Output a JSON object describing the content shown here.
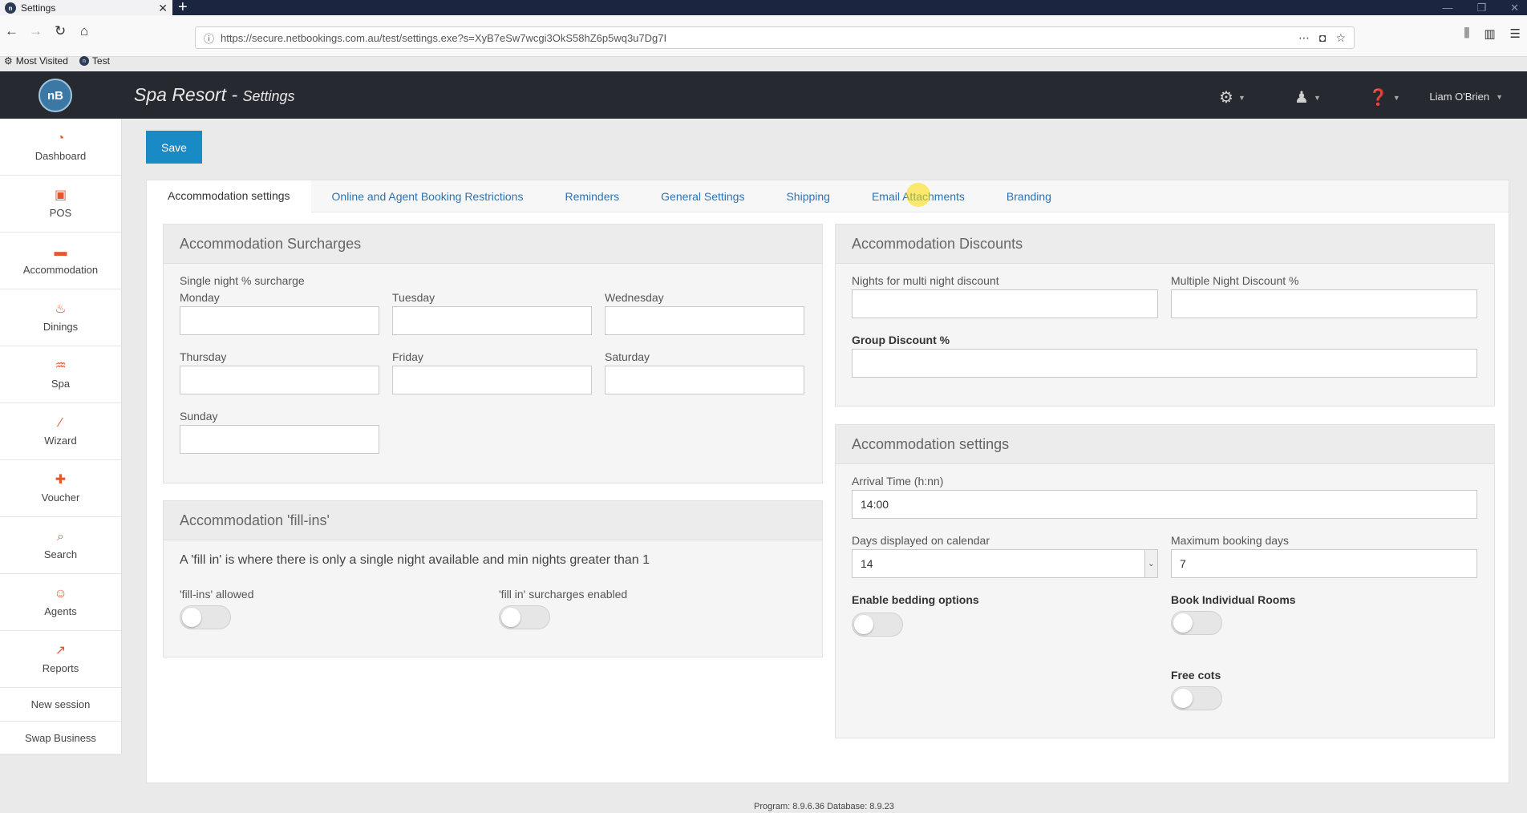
{
  "browser": {
    "tab_title": "Settings",
    "tab_close": "✕",
    "new_tab": "+",
    "url": "https://secure.netbookings.com.au/test/settings.exe?s=XyB7eSw7wcgi3OkS58hZ6p5wq3u7Dg7I",
    "bookmarks": [
      "Most Visited",
      "Test"
    ]
  },
  "app": {
    "logo": "nB",
    "title": "Spa Resort - ",
    "subtitle": "Settings",
    "user_name": "Liam O'Brien"
  },
  "sidebar": {
    "items": [
      {
        "label": "Dashboard",
        "icon": "dashboard-icon"
      },
      {
        "label": "POS",
        "icon": "pos-icon"
      },
      {
        "label": "Accommodation",
        "icon": "bed-icon"
      },
      {
        "label": "Dinings",
        "icon": "dining-icon"
      },
      {
        "label": "Spa",
        "icon": "spa-icon"
      },
      {
        "label": "Wizard",
        "icon": "wand-icon"
      },
      {
        "label": "Voucher",
        "icon": "gift-icon"
      },
      {
        "label": "Search",
        "icon": "search-icon"
      },
      {
        "label": "Agents",
        "icon": "agent-icon"
      },
      {
        "label": "Reports",
        "icon": "chart-icon"
      }
    ],
    "links": [
      "New session",
      "Swap Business"
    ]
  },
  "toolbar": {
    "save_label": "Save"
  },
  "tabs": [
    "Accommodation settings",
    "Online and Agent Booking Restrictions",
    "Reminders",
    "General Settings",
    "Shipping",
    "Email Attachments",
    "Branding"
  ],
  "surcharges": {
    "title": "Accommodation Surcharges",
    "subtitle": "Single night % surcharge",
    "days": [
      "Monday",
      "Tuesday",
      "Wednesday",
      "Thursday",
      "Friday",
      "Saturday",
      "Sunday"
    ]
  },
  "fillins": {
    "title": "Accommodation 'fill-ins'",
    "note": "A 'fill in' is where there is only a single night available and min nights greater than 1",
    "allowed_label": "'fill-ins' allowed",
    "surcharges_label": "'fill in' surcharges enabled"
  },
  "discounts": {
    "title": "Accommodation Discounts",
    "nights_label": "Nights for multi night discount",
    "multi_label": "Multiple Night Discount %",
    "group_label": "Group Discount %"
  },
  "acc_settings": {
    "title": "Accommodation settings",
    "arrival_label": "Arrival Time (h:nn)",
    "arrival_value": "14:00",
    "days_label": "Days displayed on calendar",
    "days_value": "14",
    "max_label": "Maximum booking days",
    "max_value": "7",
    "bedding_label": "Enable bedding options",
    "individual_label": "Book Individual Rooms",
    "cots_label": "Free cots"
  },
  "footer": "Program: 8.9.6.36 Database: 8.9.23"
}
